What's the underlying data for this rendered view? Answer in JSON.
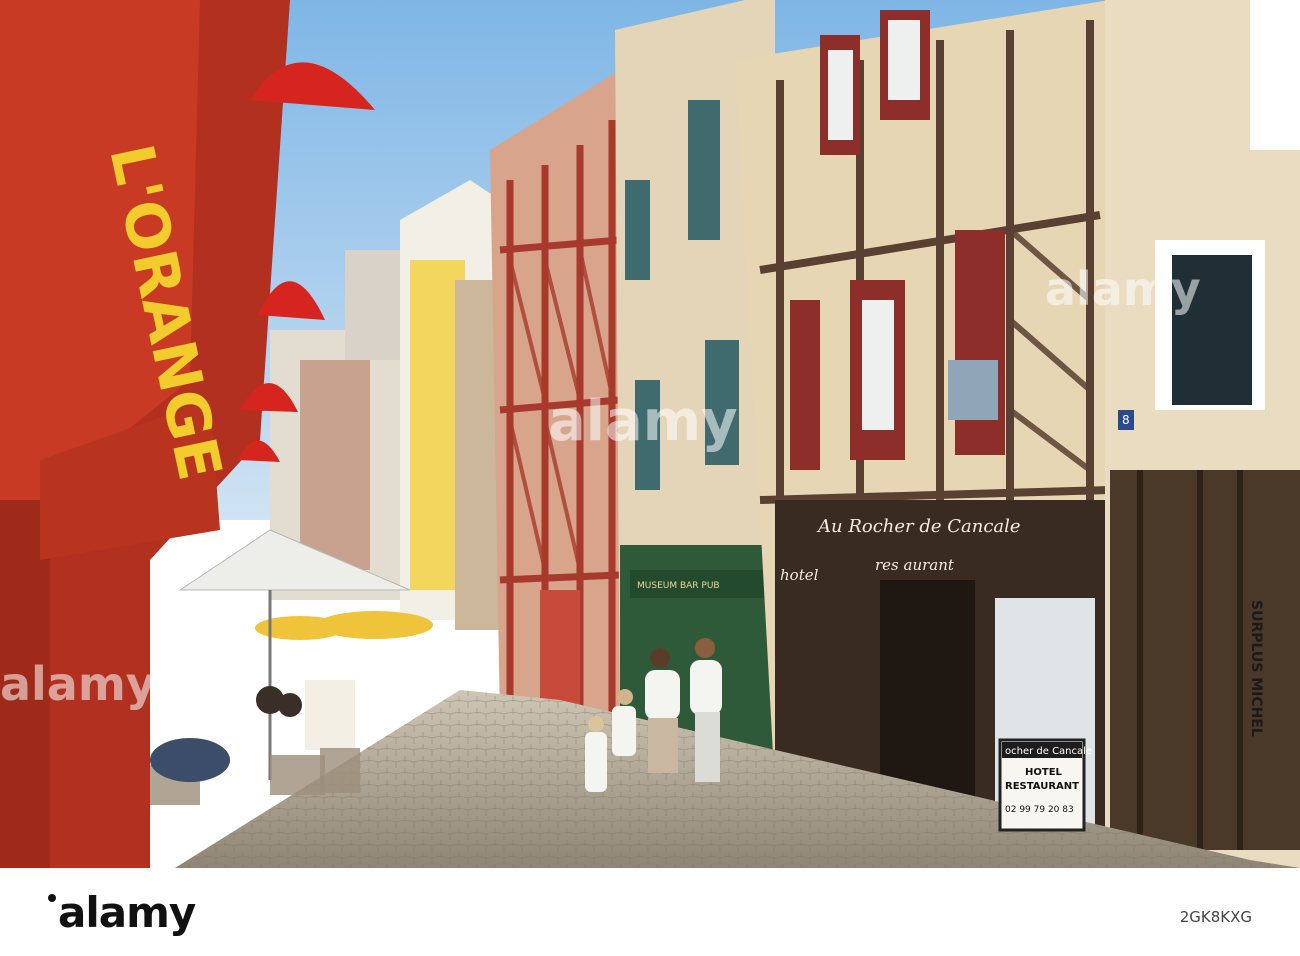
{
  "photo": {
    "caption": "Half-timbered houses on a cobbled street",
    "signs": {
      "restaurant_facade": "Au Rocher de Cancale",
      "hotel_word": "hotel",
      "restaurant_word": "res aurant",
      "board_line1": "ocher de Cancale",
      "board_line2": "HOTEL",
      "board_line3": "RESTAURANT",
      "board_phone": "02 99 79 20 83",
      "house_number": "8",
      "green_shop": "MUSEUM BAR PUB",
      "vertical_sign": "SURPLUS MICHEL"
    }
  },
  "watermarks": {
    "center": "alamy",
    "left": "alamy",
    "right": "alamy"
  },
  "footer": {
    "logo": "alamy",
    "image_ref": "2GK8KXG"
  }
}
